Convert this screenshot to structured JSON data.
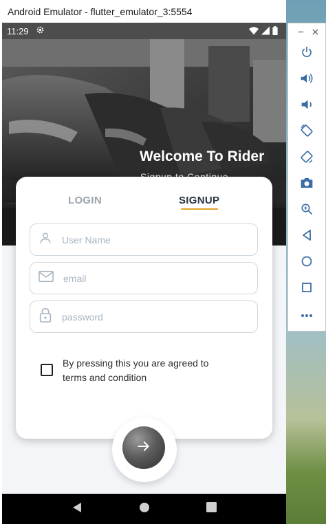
{
  "window": {
    "title": "Android Emulator - flutter_emulator_3:5554"
  },
  "statusbar": {
    "time": "11:29"
  },
  "hero": {
    "title": "Welcome To Rider",
    "subtitle": "Signup to Continue"
  },
  "tabs": {
    "login": "LOGIN",
    "signup": "SIGNUP",
    "active": "SIGNUP"
  },
  "form": {
    "username_placeholder": "User Name",
    "email_placeholder": "email",
    "password_placeholder": "password",
    "terms_text": "By pressing this you are agreed to terms and condition",
    "terms_checked": false
  },
  "colors": {
    "accent_underline": "#e0a227",
    "tab_active": "#2a3344",
    "tab_inactive": "#9aa3ad",
    "field_border": "#cfd8df",
    "placeholder": "#a9b6c2",
    "emulator_icon": "#3b6ea5"
  },
  "icons": {
    "status": [
      "gear-icon",
      "wifi-icon",
      "signal-icon",
      "battery-icon"
    ],
    "fields": [
      "person-icon",
      "mail-icon",
      "lock-icon"
    ],
    "submit": "arrow-right-icon",
    "navbar": [
      "back-icon",
      "home-icon",
      "overview-icon"
    ],
    "emulator_tools": [
      "minimize-icon",
      "close-icon",
      "power-icon",
      "volume-up-icon",
      "volume-down-icon",
      "rotate-left-icon",
      "rotate-right-icon",
      "camera-icon",
      "zoom-icon",
      "back-icon",
      "home-icon",
      "overview-icon",
      "more-icon"
    ]
  }
}
